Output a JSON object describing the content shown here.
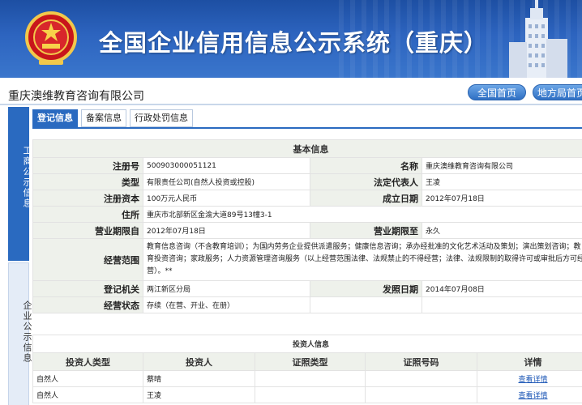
{
  "header": {
    "title": "全国企业信用信息公示系统（重庆）"
  },
  "company": {
    "name": "重庆澳维教育咨询有限公司"
  },
  "nav": {
    "home": "全国首页",
    "local": "地方局首页"
  },
  "sidebar": {
    "items": [
      {
        "label": "工商公示信息"
      },
      {
        "label": "企业公示信息"
      }
    ]
  },
  "tabs": [
    {
      "label": "登记信息"
    },
    {
      "label": "备案信息"
    },
    {
      "label": "行政处罚信息"
    }
  ],
  "basic_info": {
    "title": "基本信息",
    "reg_no_label": "注册号",
    "reg_no": "500903000051121",
    "name_label": "名称",
    "name": "重庆澳维教育咨询有限公司",
    "type_label": "类型",
    "type": "有限责任公司(自然人投资或控股)",
    "legal_rep_label": "法定代表人",
    "legal_rep": "王凌",
    "capital_label": "注册资本",
    "capital": "100万元人民币",
    "established_label": "成立日期",
    "established": "2012年07月18日",
    "address_label": "住所",
    "address": "重庆市北部新区金渝大道89号13幢3-1",
    "term_from_label": "营业期限自",
    "term_from": "2012年07月18日",
    "term_to_label": "营业期限至",
    "term_to": "永久",
    "scope_label": "经营范围",
    "scope": "教育信息咨询（不含教育培训）；为国内劳务企业提供派遣服务；健康信息咨询；承办经批准的文化艺术活动及策划；演出策划咨询；教育投资咨询；家政服务；人力资源管理咨询服务（以上经营范围法律、法规禁止的不得经营；法律、法规限制的取得许可或审批后方可经营）。**",
    "authority_label": "登记机关",
    "authority": "两江新区分局",
    "issue_date_label": "发照日期",
    "issue_date": "2014年07月08日",
    "status_label": "经营状态",
    "status": "存续（在营、开业、在册）"
  },
  "investors": {
    "title": "投资人信息",
    "headers": [
      "投资人类型",
      "投资人",
      "证照类型",
      "证照号码",
      "详情"
    ],
    "rows": [
      {
        "type": "自然人",
        "name": "蔡晴",
        "id_type": "",
        "id_no": "",
        "detail": "查看详情"
      },
      {
        "type": "自然人",
        "name": "王凌",
        "id_type": "",
        "id_no": "",
        "detail": "查看详情"
      }
    ]
  }
}
